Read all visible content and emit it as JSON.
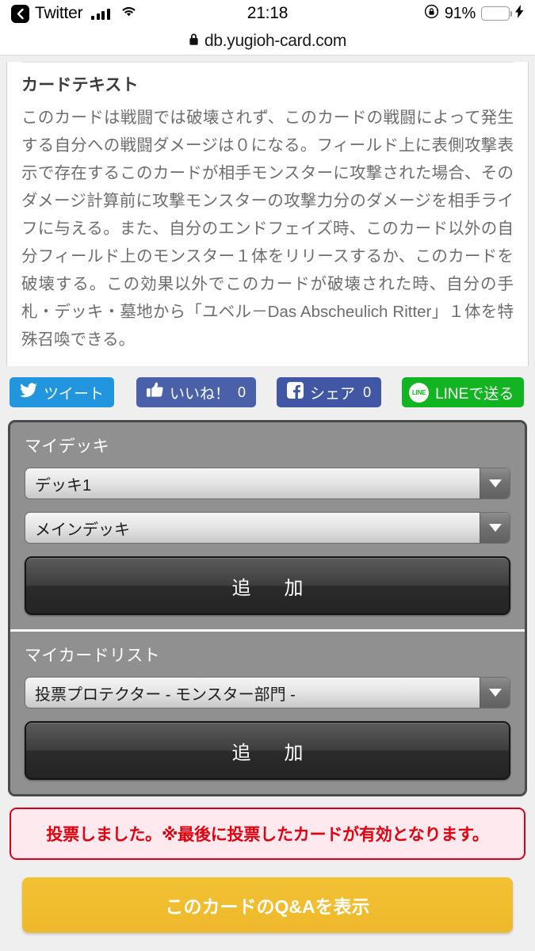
{
  "status_bar": {
    "back_label": "Twitter",
    "back_icon": "chevron-left-icon",
    "signal_icon": "cellular-bars-icon",
    "wifi_icon": "wifi-icon",
    "time": "21:18",
    "rotation_lock_icon": "rotation-lock-icon",
    "battery_percent": "91%",
    "battery_level": 91,
    "battery_icon": "battery-icon",
    "charging_icon": "lightning-bolt-icon"
  },
  "browser": {
    "lock_icon": "lock-icon",
    "host": "db.yugioh-card.com"
  },
  "card_text_section": {
    "heading": "カードテキスト",
    "body": "このカードは戦闘では破壊されず、このカードの戦闘によって発生する自分への戦闘ダメージは０になる。フィールド上に表側攻撃表示で存在するこのカードが相手モンスターに攻撃された場合、そのダメージ計算前に攻撃モンスターの攻撃力分のダメージを相手ライフに与える。また、自分のエンドフェイズ時、このカード以外の自分フィールド上のモンスター１体をリリースするか、このカードを破壊する。この効果以外でこのカードが破壊された時、自分の手札・デッキ・墓地から「ユベル－Das Abscheulich Ritter」１体を特殊召喚できる。"
  },
  "social": {
    "twitter": {
      "label": "ツイート",
      "icon": "twitter-bird-icon",
      "color": "#2196de"
    },
    "like": {
      "label": "いいね！",
      "count": "0",
      "icon": "thumbs-up-icon",
      "color": "#4a60a9"
    },
    "share": {
      "label": "シェア",
      "count": "0",
      "icon": "facebook-f-icon",
      "color": "#4157a6"
    },
    "line": {
      "label": "LINEで送る",
      "badge": "LINE",
      "icon": "line-icon",
      "color": "#12b521"
    }
  },
  "my_deck": {
    "heading": "マイデッキ",
    "deck_select": {
      "value": "デッキ1",
      "arrow_icon": "caret-down-icon"
    },
    "part_select": {
      "value": "メインデッキ",
      "arrow_icon": "caret-down-icon"
    },
    "add_button": "追　加"
  },
  "my_card_list": {
    "heading": "マイカードリスト",
    "list_select": {
      "value": "投票プロテクター - モンスター部門 -",
      "arrow_icon": "caret-down-icon"
    },
    "add_button": "追　加"
  },
  "alert": {
    "message": "投票しました。※最後に投票したカードが有効となります。",
    "text_color": "#e2000f",
    "border_color": "#d7001d",
    "background_color": "#fde9ee"
  },
  "qa_button": {
    "label": "このカードのQ&Aを表示",
    "color": "#eeb92c"
  }
}
